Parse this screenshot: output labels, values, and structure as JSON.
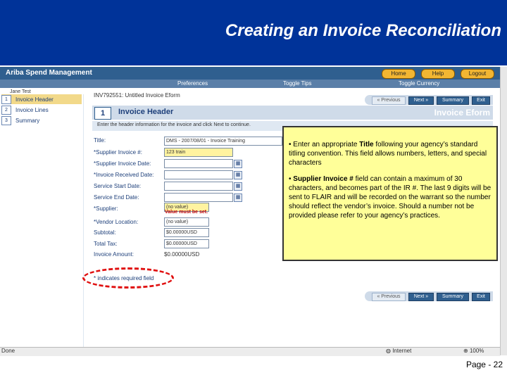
{
  "slide": {
    "title": "Creating an Invoice Reconciliation",
    "page_number": "Page - 22"
  },
  "app": {
    "logo": "Ariba Spend Management",
    "buttons": {
      "home": "Home",
      "help": "Help",
      "logout": "Logout"
    },
    "subnav": {
      "preferences": "Preferences",
      "toggle_tips": "Toggle Tips",
      "toggle_currency": "Toggle Currency"
    },
    "user": "Jane Test"
  },
  "leftnav": {
    "items": [
      {
        "num": "1",
        "label": "Invoice Header",
        "active": true
      },
      {
        "num": "2",
        "label": "Invoice Lines",
        "active": false
      },
      {
        "num": "3",
        "label": "Summary",
        "active": false
      }
    ]
  },
  "form": {
    "breadcrumb": "INV792551: Untitled Invoice Eform",
    "step": "1",
    "section_title": "Invoice Header",
    "eform_title": "Invoice Eform",
    "instructions": "Enter the header information for the invoice and click Next to continue.",
    "nav_buttons": {
      "previous": "« Previous",
      "next": "Next »",
      "summary": "Summary",
      "exit": "Exit"
    },
    "fields": {
      "title_label": "Title:",
      "title_value": "DMS - 2007/08/01 - Invoice Training",
      "supplier_invoice_label": "*Supplier Invoice #:",
      "supplier_invoice_value": "123 train",
      "supplier_invoice_date_label": "*Supplier Invoice Date:",
      "invoice_received_date_label": "*Invoice Received Date:",
      "service_start_date_label": "Service Start Date:",
      "service_end_date_label": "Service End Date:",
      "supplier_label": "*Supplier:",
      "supplier_value": "(no value)",
      "supplier_error": "Value must be set.",
      "vendor_location_label": "*Vendor Location:",
      "vendor_location_value": "(no value)",
      "subtotal_label": "Subtotal:",
      "subtotal_value": "$0.00000USD",
      "total_tax_label": "Total Tax:",
      "total_tax_value": "$0.00000USD",
      "invoice_amount_label": "Invoice Amount:",
      "invoice_amount_value": "$0.00000USD"
    },
    "required_note": "* indicates required field",
    "calendar_icon": "calendar-icon"
  },
  "callout": {
    "p1_prefix": "• Enter an appropriate ",
    "p1_bold": "Title",
    "p1_rest": " following your agency’s standard titling convention.   This field allows numbers, letters, and special characters",
    "p2_prefix": "• ",
    "p2_bold": "Supplier Invoice #",
    "p2_rest": " field can contain a maximum of 30 characters, and becomes part of the IR #. The last 9 digits will be sent to FLAIR and will be recorded on the warrant so the number should reflect the vendor’s invoice. Should a number not be provided please refer to your agency’s practices."
  },
  "statusbar": {
    "left": "Done",
    "zone": "Internet",
    "zoom": "100%"
  },
  "colors": {
    "title_band": "#003399",
    "callout_bg": "#ffff99",
    "ellipse": "#e01010"
  }
}
